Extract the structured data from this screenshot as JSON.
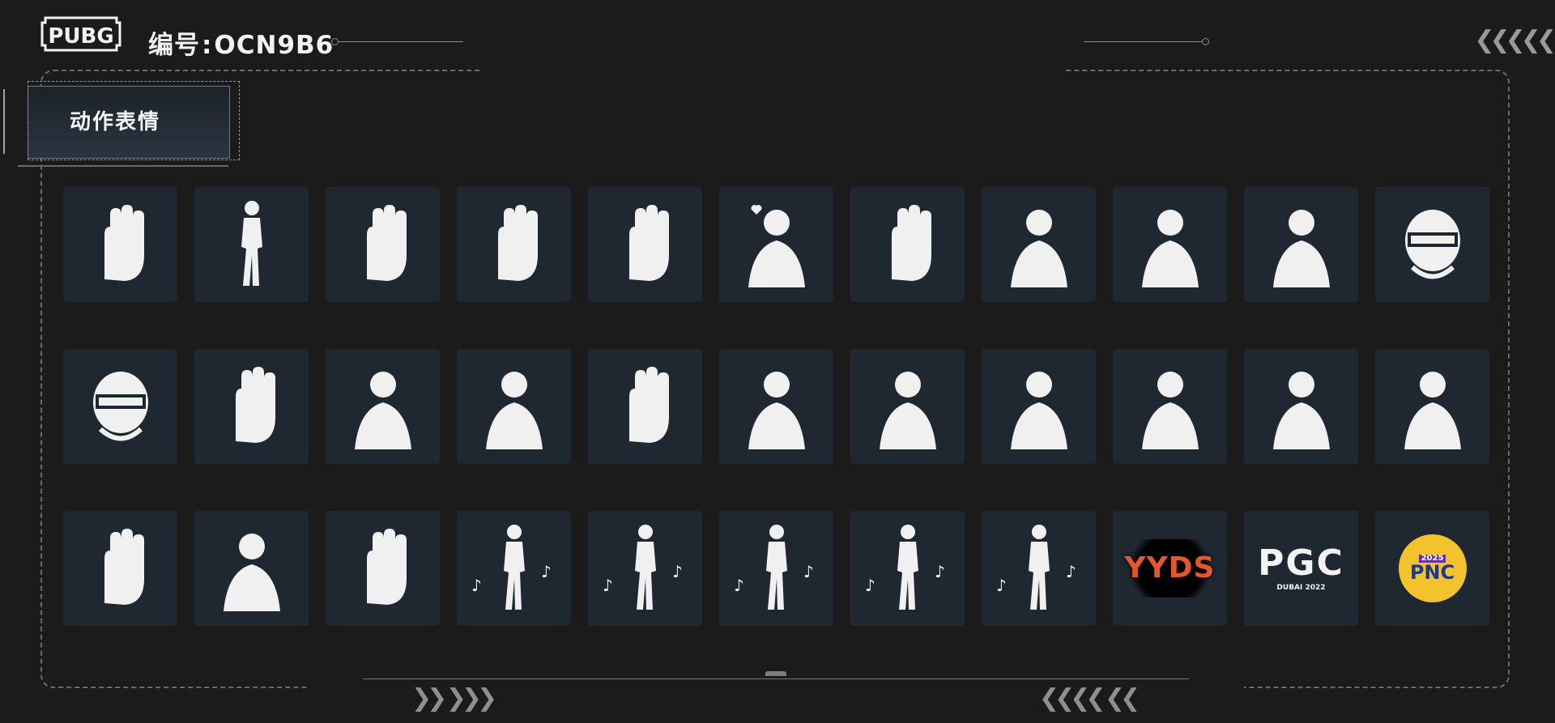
{
  "header": {
    "logo_text": "PUBG",
    "serial_label": "编号",
    "serial_sep": ":",
    "serial_value": "OCN9B6"
  },
  "category": {
    "label": "动作表情"
  },
  "emotes": [
    {
      "icon": "coin-flip-icon"
    },
    {
      "icon": "shy-pose-icon"
    },
    {
      "icon": "cupped-hands-icon"
    },
    {
      "icon": "hand-on-head-icon"
    },
    {
      "icon": "nervous-hands-icon"
    },
    {
      "icon": "heart-gesture-icon"
    },
    {
      "icon": "hands-up-icon"
    },
    {
      "icon": "wave-icon"
    },
    {
      "icon": "head-turn-icon"
    },
    {
      "icon": "resting-arm-icon"
    },
    {
      "icon": "helmet-angry-icon"
    },
    {
      "icon": "helmet-laugh-icon"
    },
    {
      "icon": "clapping-icon"
    },
    {
      "icon": "nose-pick-icon"
    },
    {
      "icon": "dizzy-icon"
    },
    {
      "icon": "pointing-icon"
    },
    {
      "icon": "shrug-thinking-icon"
    },
    {
      "icon": "confused-shrug-icon"
    },
    {
      "icon": "sad-arms-crossed-icon"
    },
    {
      "icon": "kick-icon"
    },
    {
      "icon": "face-palm-cry-icon"
    },
    {
      "icon": "facepalm-icon"
    },
    {
      "icon": "stop-hand-icon"
    },
    {
      "icon": "arms-crossed-icon"
    },
    {
      "icon": "thumbs-up-icon"
    },
    {
      "icon": "ballet-dance-icon"
    },
    {
      "icon": "music-dance-icon"
    },
    {
      "icon": "duo-dance-icon"
    },
    {
      "icon": "jump-dance-icon"
    },
    {
      "icon": "check-watch-dance-icon"
    },
    {
      "icon": "yyds-icon",
      "text": "YYDS"
    },
    {
      "icon": "pgc-icon",
      "text": "PGC",
      "subtext": "DUBAI 2022"
    },
    {
      "icon": "pnc-icon",
      "text": "PNC",
      "subtext": "2025"
    }
  ],
  "colors": {
    "background": "#1b1b1c",
    "tile": "#1f2731",
    "frame": "#6a6a6a",
    "silhouette": "#f0f0f0"
  }
}
